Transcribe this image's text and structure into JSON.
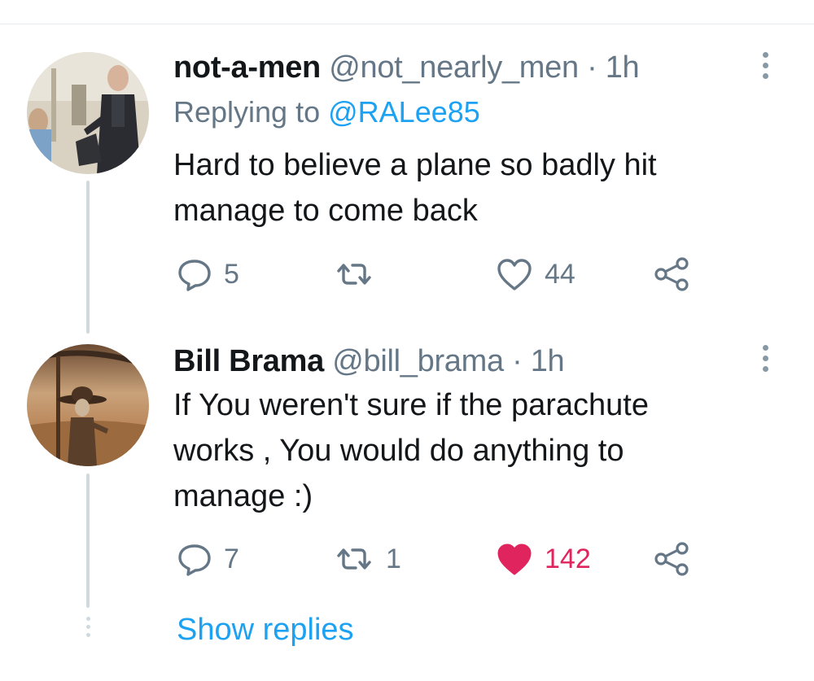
{
  "tweets": [
    {
      "display_name": "not-a-men",
      "handle": "@not_nearly_men",
      "separator": "·",
      "time": "1h",
      "replying_prefix": "Replying to",
      "replying_to": "@RALee85",
      "text_line1": "Hard to believe a plane so badly hit",
      "text_line2": "manage to come back",
      "replies": "5",
      "retweets": "",
      "likes": "44",
      "liked": false
    },
    {
      "display_name": "Bill Brama",
      "handle": "@bill_brama",
      "separator": "·",
      "time": "1h",
      "text_line1": "If  You weren't sure if the parachute",
      "text_line2": "works , You would do anything to",
      "text_line3": "manage :)",
      "replies": "7",
      "retweets": "1",
      "likes": "142",
      "liked": true
    }
  ],
  "show_replies": "Show replies",
  "colors": {
    "accent": "#1da1f2",
    "like_red": "#e0245e",
    "secondary_text": "#657786",
    "thread_line": "#cfd9de"
  }
}
